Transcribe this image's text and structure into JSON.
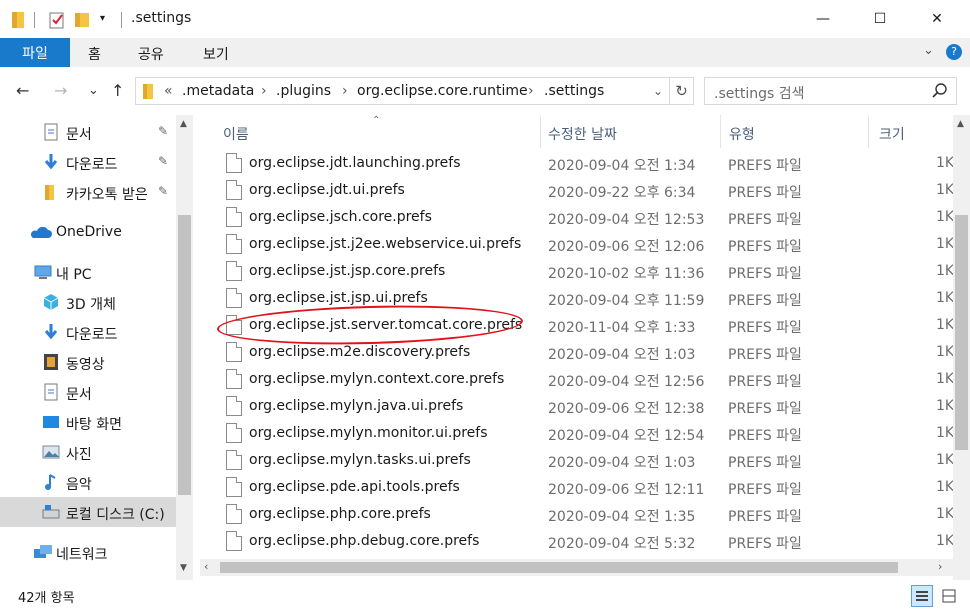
{
  "window": {
    "title": ".settings",
    "minimize": "—",
    "maximize": "☐",
    "close": "✕"
  },
  "ribbon": {
    "tabs": [
      "파일",
      "홈",
      "공유",
      "보기"
    ],
    "expand": "⌄",
    "help": "?"
  },
  "address": {
    "back": "←",
    "forward": "→",
    "recent": "⌄",
    "up": "↑",
    "overflow": "«",
    "crumbs": [
      ".metadata",
      ".plugins",
      "org.eclipse.core.runtime",
      ".settings"
    ],
    "dropdown": "⌄",
    "refresh": "↻"
  },
  "search": {
    "placeholder": ".settings 검색",
    "icon": "search-icon"
  },
  "nav": {
    "items": [
      {
        "label": "문서",
        "icon": "document-icon",
        "pinned": true
      },
      {
        "label": "다운로드",
        "icon": "download-icon",
        "pinned": true
      },
      {
        "label": "카카오톡 받은",
        "icon": "folder-icon",
        "pinned": true
      },
      {
        "label": "OneDrive",
        "icon": "cloud-icon"
      },
      {
        "label": "내 PC",
        "icon": "pc-icon"
      },
      {
        "label": "3D 개체",
        "icon": "3d-icon"
      },
      {
        "label": "다운로드",
        "icon": "download-icon"
      },
      {
        "label": "동영상",
        "icon": "video-icon"
      },
      {
        "label": "문서",
        "icon": "document-icon"
      },
      {
        "label": "바탕 화면",
        "icon": "desktop-icon"
      },
      {
        "label": "사진",
        "icon": "picture-icon"
      },
      {
        "label": "음악",
        "icon": "music-icon"
      },
      {
        "label": "로컬 디스크 (C:)",
        "icon": "drive-icon"
      },
      {
        "label": "네트워크",
        "icon": "network-icon"
      }
    ],
    "pin_glyph": "📌"
  },
  "columns": {
    "name": "이름",
    "date": "수정한 날짜",
    "type": "유형",
    "size": "크기"
  },
  "files": [
    {
      "name": "org.eclipse.jdt.launching.prefs",
      "date": "2020-09-04 오전 1:34",
      "type": "PREFS 파일",
      "size": "1K"
    },
    {
      "name": "org.eclipse.jdt.ui.prefs",
      "date": "2020-09-22 오후 6:34",
      "type": "PREFS 파일",
      "size": "1K"
    },
    {
      "name": "org.eclipse.jsch.core.prefs",
      "date": "2020-09-04 오전 12:53",
      "type": "PREFS 파일",
      "size": "1K"
    },
    {
      "name": "org.eclipse.jst.j2ee.webservice.ui.prefs",
      "date": "2020-09-06 오전 12:06",
      "type": "PREFS 파일",
      "size": "1K"
    },
    {
      "name": "org.eclipse.jst.jsp.core.prefs",
      "date": "2020-10-02 오후 11:36",
      "type": "PREFS 파일",
      "size": "1K"
    },
    {
      "name": "org.eclipse.jst.jsp.ui.prefs",
      "date": "2020-09-04 오후 11:59",
      "type": "PREFS 파일",
      "size": "1K"
    },
    {
      "name": "org.eclipse.jst.server.tomcat.core.prefs",
      "date": "2020-11-04 오후 1:33",
      "type": "PREFS 파일",
      "size": "1K"
    },
    {
      "name": "org.eclipse.m2e.discovery.prefs",
      "date": "2020-09-04 오전 1:03",
      "type": "PREFS 파일",
      "size": "1K"
    },
    {
      "name": "org.eclipse.mylyn.context.core.prefs",
      "date": "2020-09-04 오전 12:56",
      "type": "PREFS 파일",
      "size": "1K"
    },
    {
      "name": "org.eclipse.mylyn.java.ui.prefs",
      "date": "2020-09-06 오전 12:38",
      "type": "PREFS 파일",
      "size": "1K"
    },
    {
      "name": "org.eclipse.mylyn.monitor.ui.prefs",
      "date": "2020-09-04 오전 12:54",
      "type": "PREFS 파일",
      "size": "1K"
    },
    {
      "name": "org.eclipse.mylyn.tasks.ui.prefs",
      "date": "2020-09-04 오전 1:03",
      "type": "PREFS 파일",
      "size": "1K"
    },
    {
      "name": "org.eclipse.pde.api.tools.prefs",
      "date": "2020-09-06 오전 12:11",
      "type": "PREFS 파일",
      "size": "1K"
    },
    {
      "name": "org.eclipse.php.core.prefs",
      "date": "2020-09-04 오전 1:35",
      "type": "PREFS 파일",
      "size": "1K"
    },
    {
      "name": "org.eclipse.php.debug.core.prefs",
      "date": "2020-09-04 오전 5:32",
      "type": "PREFS 파일",
      "size": "1K"
    }
  ],
  "status": {
    "count": "42개 항목"
  },
  "colors": {
    "accent": "#1979ca",
    "selection": "#cce8ff",
    "annotation": "#e0121a"
  }
}
